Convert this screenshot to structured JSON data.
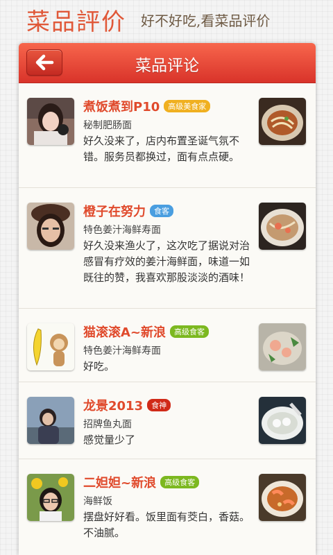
{
  "header": {
    "title": "菜品評价",
    "slogan": "好不好吃,看菜品评价"
  },
  "topbar": {
    "title": "菜品评论",
    "back_icon": "arrow-left-icon"
  },
  "colors": {
    "accent": "#e04a2c",
    "bar": "#e8443a",
    "badge_yellow": "#f0b020",
    "badge_blue": "#4a9ee0",
    "badge_green": "#7cb820",
    "badge_red": "#d02a18"
  },
  "reviews": [
    {
      "user": "煮饭煮到P10",
      "badge": "高级美食家",
      "badge_color": "#f0b020",
      "dish": "秘制肥肠面",
      "comment": "好久没来了，店内布置圣诞气氛不错。服务员都换过，面有点点硬。"
    },
    {
      "user": "橙子在努力",
      "badge": "食客",
      "badge_color": "#4a9ee0",
      "dish": "特色姜汁海鲜寿面",
      "comment": "好久没来渔火了，这次吃了据说对治感冒有疗效的姜汁海鲜面，味道一如既往的赞，我喜欢那股淡淡的酒味！"
    },
    {
      "user": "猫滚滚A~新浪",
      "badge": "高级食客",
      "badge_color": "#7cb820",
      "dish": "特色姜汁海鲜寿面",
      "comment": "好吃。"
    },
    {
      "user": "龙景2013",
      "badge": "食神",
      "badge_color": "#d02a18",
      "dish": "招牌鱼丸面",
      "comment": "感觉量少了"
    },
    {
      "user": "二妲妲~新浪",
      "badge": "高级食客",
      "badge_color": "#7cb820",
      "dish": "海鲜饭",
      "comment": "摆盘好好看。饭里面有茭白，香菇。不油腻。"
    }
  ]
}
